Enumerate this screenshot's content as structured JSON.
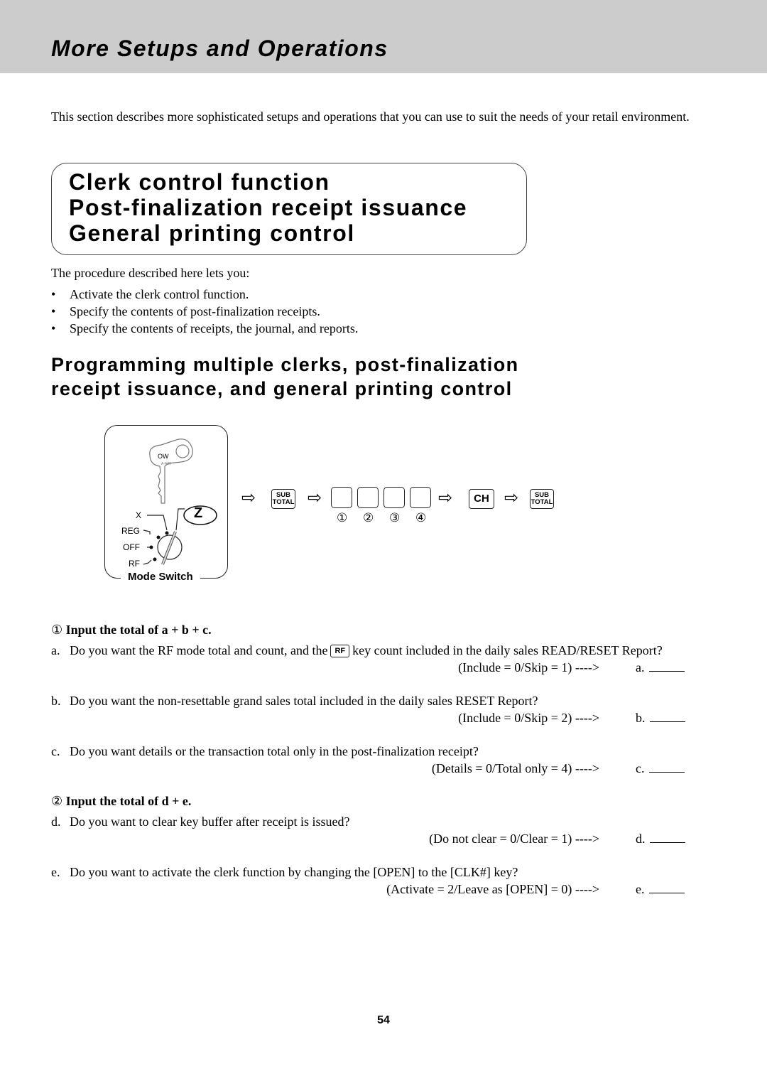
{
  "header": {
    "title": "More Setups and Operations"
  },
  "intro": "This section describes more sophisticated setups and operations that you can use to suit the needs of your retail environment.",
  "title_box": {
    "lines": [
      "Clerk control function",
      "Post-finalization receipt issuance",
      "General printing control"
    ]
  },
  "procedure": {
    "lead": "The procedure described here lets you:",
    "bullet_glyph": "•",
    "items": [
      "Activate the clerk control function.",
      "Specify the contents of post-finalization receipts.",
      "Specify the contents of receipts, the journal, and reports."
    ]
  },
  "section_heading": {
    "lines": [
      "Programming multiple clerks, post-finalization",
      "receipt issuance, and general printing control"
    ]
  },
  "mode_switch": {
    "label": "Mode Switch",
    "key_text": "OW",
    "key_code": "A-A00",
    "positions": [
      "X",
      "REG",
      "OFF",
      "RF"
    ],
    "selected": "Z"
  },
  "key_sequence": {
    "arrow_glyph": "⇨",
    "subtotal_line1": "SUB",
    "subtotal_line2": "TOTAL",
    "ch_label": "CH",
    "digit_markers": [
      "①",
      "②",
      "③",
      "④"
    ]
  },
  "steps": [
    {
      "marker": "①",
      "title": "Input the total of a + b + c.",
      "questions": [
        {
          "label": "a.",
          "text_before": "Do you want the RF mode total and count, and the",
          "key": "RF",
          "text_after": "key count included in the daily sales READ/RESET Report?",
          "options": "(Include = 0/Skip = 1) ---->",
          "answer_label": "a."
        },
        {
          "label": "b.",
          "text": "Do you want the non-resettable grand sales total included in the daily sales RESET Report?",
          "options": "(Include = 0/Skip = 2) ---->",
          "answer_label": "b."
        },
        {
          "label": "c.",
          "text": "Do you want details or the transaction total only in the post-finalization receipt?",
          "options": "(Details = 0/Total only = 4) ---->",
          "answer_label": "c."
        }
      ]
    },
    {
      "marker": "②",
      "title": "Input the total of d + e.",
      "questions": [
        {
          "label": "d.",
          "text": "Do you want to clear key buffer after receipt is issued?",
          "options": "(Do not clear = 0/Clear = 1) ---->",
          "answer_label": "d."
        },
        {
          "label": "e.",
          "text": "Do you want to activate the clerk function by changing the [OPEN] to the [CLK#] key?",
          "options": "(Activate = 2/Leave as [OPEN] = 0) ---->",
          "answer_label": "e."
        }
      ]
    }
  ],
  "page_number": "54"
}
